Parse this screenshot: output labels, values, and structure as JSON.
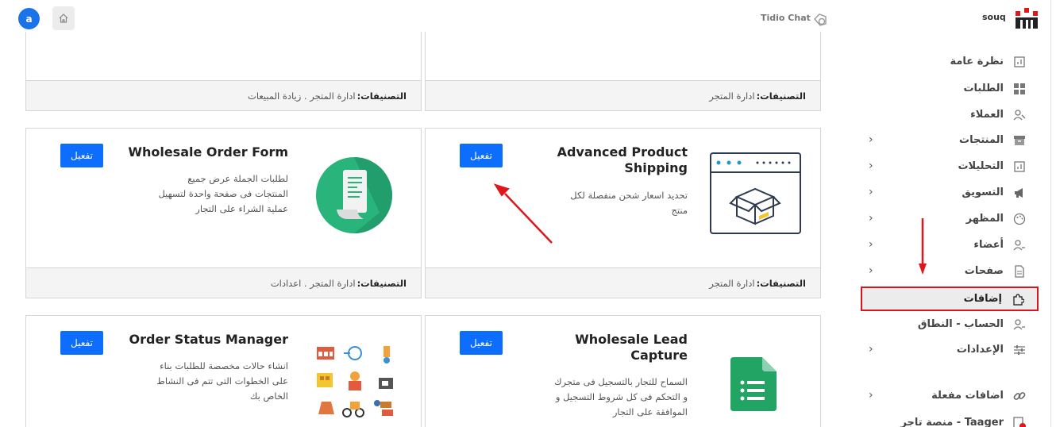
{
  "header": {
    "avatar_letter": "a",
    "tidio_label": "Tidio Chat",
    "store_name": "souq"
  },
  "cards": [
    {
      "title": "",
      "category_label": "التصنيفات:",
      "categories": " ادارة المتجر . زيادة المبيعات"
    },
    {
      "title": "",
      "category_label": "التصنيفات:",
      "categories": " ادارة المتجر"
    },
    {
      "title": "Wholesale Order Form",
      "desc_lines": [
        "لطلبات الجملة عرض جميع",
        "المنتجات فى صفحة واحدة لتسهيل",
        "عملية الشراء على التجار"
      ],
      "button": "تفعيل",
      "category_label": "التصنيفات:",
      "categories": " ادارة المتجر . اعدادات",
      "icon": "document-scroll-icon"
    },
    {
      "title": "Advanced Product Shipping",
      "title_lines": [
        "Advanced Product",
        "Shipping"
      ],
      "desc_lines": [
        "تحديد اسعار شحن منفصلة لكل",
        "منتج"
      ],
      "button": "تفعيل",
      "category_label": "التصنيفات:",
      "categories": " ادارة المتجر",
      "icon": "shipping-box-browser-icon"
    },
    {
      "title": "Order Status Manager",
      "desc_lines": [
        "انشاء حالات مخصصة للطلبات بناء",
        "على الخطوات التى تتم فى النشاط",
        "الخاص بك"
      ],
      "button": "تفعيل",
      "icon": "order-status-icons-grid"
    },
    {
      "title": "Wholesale Lead Capture",
      "title_lines": [
        "Wholesale Lead",
        "Capture"
      ],
      "desc_lines": [
        "السماح للتجار بالتسجيل فى متجرك",
        "و التحكم فى كل شروط التسجيل و",
        "الموافقة على التجار"
      ],
      "button": "تفعيل",
      "icon": "google-form-icon"
    }
  ],
  "sidebar": {
    "items": [
      {
        "label": "نظرة عامة",
        "icon": "chart-icon"
      },
      {
        "label": "الطلبات",
        "icon": "grid-icon"
      },
      {
        "label": "العملاء",
        "icon": "users-icon"
      },
      {
        "label": "المنتجات",
        "icon": "box-icon"
      },
      {
        "label": "التحليلات",
        "icon": "chart-icon"
      },
      {
        "label": "التسويق",
        "icon": "megaphone-icon"
      },
      {
        "label": "المظهر",
        "icon": "palette-icon"
      },
      {
        "label": "أعضاء",
        "icon": "users-icon"
      },
      {
        "label": "صفحات",
        "icon": "file-icon"
      },
      {
        "label": "إضافات",
        "icon": "puzzle-icon"
      },
      {
        "label": "الحساب - النطاق",
        "icon": "user-icon"
      },
      {
        "label": "الإعدادات",
        "icon": "sliders-icon"
      },
      {
        "label": "اضافات مفعلة",
        "icon": "link-icon"
      },
      {
        "label": "Taager - منصة تاجر",
        "icon": "taager-icon"
      }
    ]
  },
  "colors": {
    "accent": "#0d6efd",
    "highlight": "#d9151b",
    "arrow": "#e0161b"
  }
}
